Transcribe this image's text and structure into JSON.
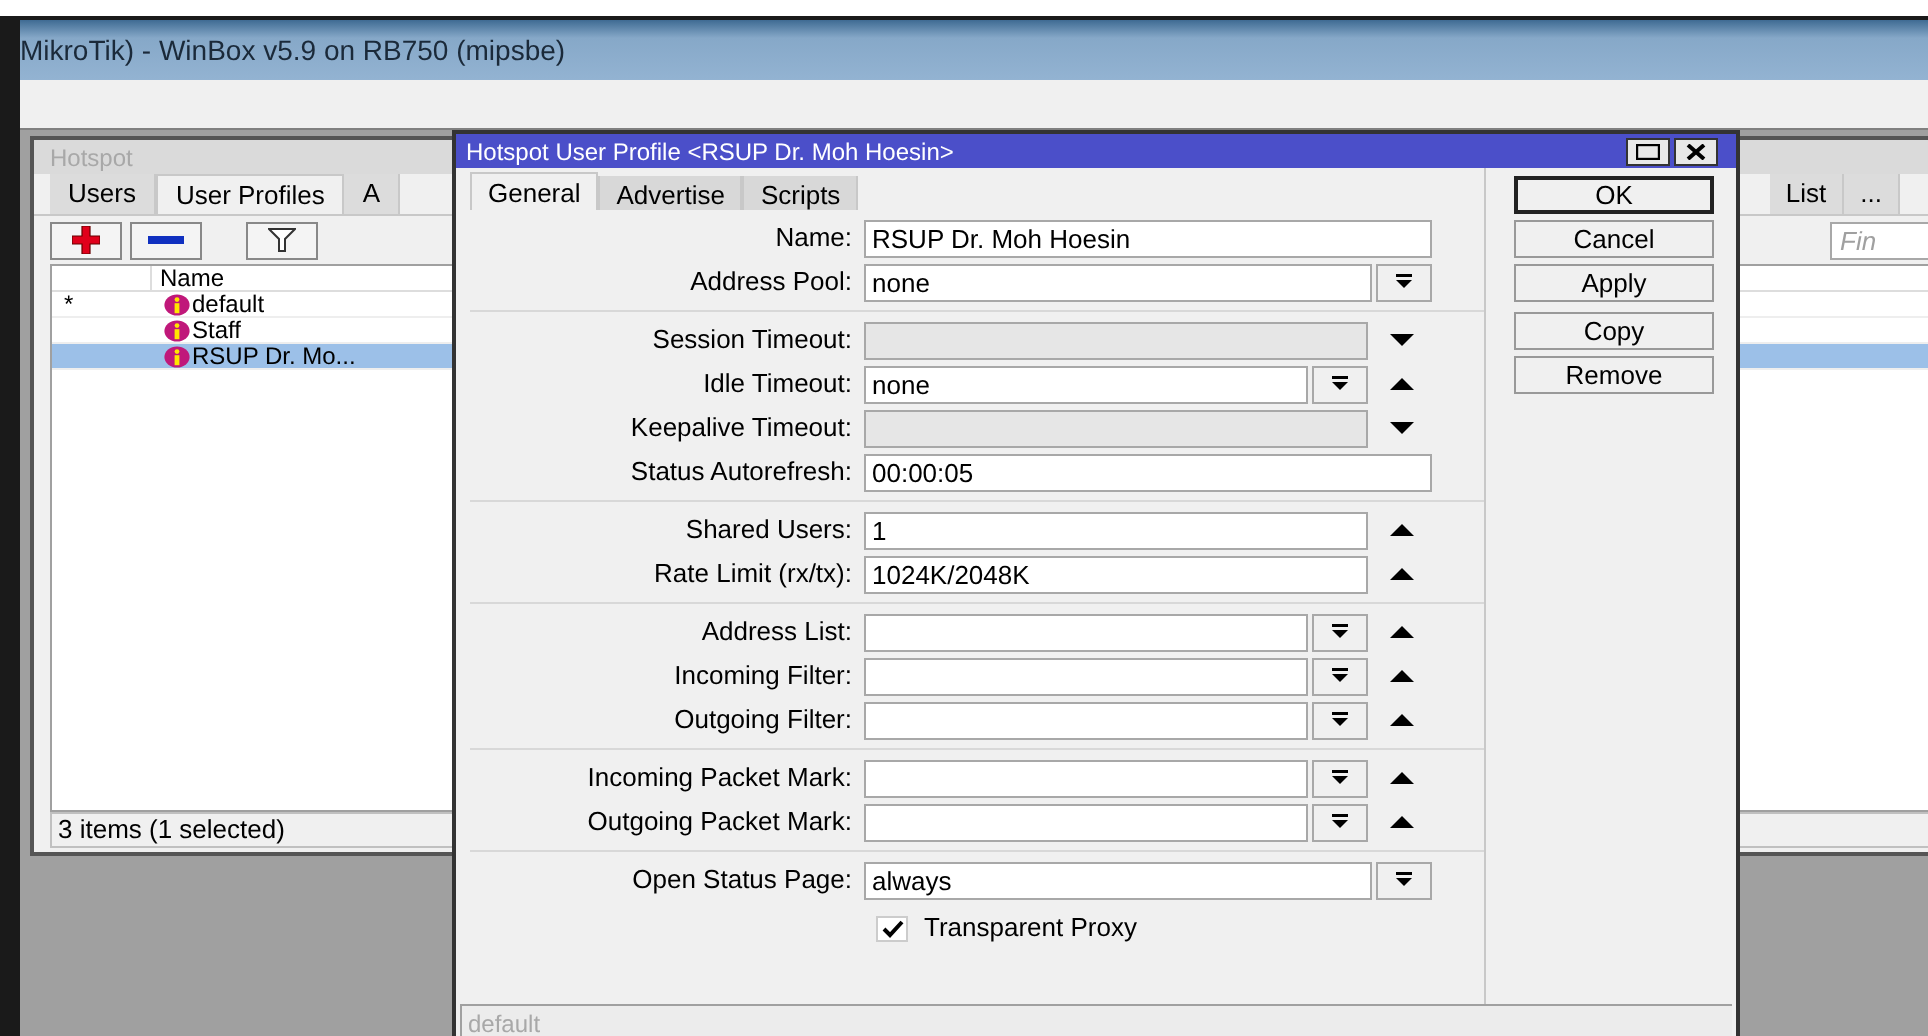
{
  "app_window": {
    "title": "MikroTik) - WinBox v5.9 on RB750 (mipsbe)"
  },
  "hotspot_window": {
    "title": "Hotspot",
    "tabs": [
      {
        "label": "Users",
        "selected": false
      },
      {
        "label": "User Profiles",
        "selected": true
      },
      {
        "label": "A",
        "selected": false
      }
    ],
    "right_tabs": [
      {
        "label": "List",
        "selected": false
      },
      {
        "label": "...",
        "selected": false
      }
    ],
    "find": {
      "placeholder": "Fin"
    },
    "table": {
      "columns": [
        "Name"
      ],
      "rows": [
        {
          "flag": "*",
          "name": "default",
          "selected": false
        },
        {
          "name": "Staff",
          "selected": false
        },
        {
          "name": "RSUP Dr. Mo...",
          "selected": true
        }
      ]
    },
    "status_bar": "3 items (1 selected)"
  },
  "dialog": {
    "title": "Hotspot User Profile <RSUP Dr. Moh Hoesin>",
    "tabs": [
      {
        "label": "General",
        "selected": true
      },
      {
        "label": "Advertise",
        "selected": false
      },
      {
        "label": "Scripts",
        "selected": false
      }
    ],
    "sections": [
      [
        {
          "kind": "plain",
          "label": "Name:",
          "value": "RSUP Dr. Moh Hoesin",
          "disabled": false,
          "dropdown": false
        },
        {
          "kind": "plain",
          "label": "Address Pool:",
          "value": "none",
          "disabled": false,
          "dropdown": true
        }
      ],
      [
        {
          "kind": "expandable",
          "label": "Session Timeout:",
          "disabled": true,
          "dropdown": false,
          "expanded": false
        },
        {
          "kind": "expandable",
          "label": "Idle Timeout:",
          "value": "none",
          "disabled": false,
          "dropdown": true,
          "expanded": true
        },
        {
          "kind": "expandable",
          "label": "Keepalive Timeout:",
          "disabled": true,
          "dropdown": false,
          "expanded": false
        },
        {
          "kind": "plain",
          "label": "Status Autorefresh:",
          "value": "00:00:05",
          "disabled": false,
          "dropdown": false
        }
      ],
      [
        {
          "kind": "expandable",
          "label": "Shared Users:",
          "value": "1",
          "disabled": false,
          "dropdown": false,
          "expanded": true
        },
        {
          "kind": "expandable",
          "label": "Rate Limit (rx/tx):",
          "value": "1024K/2048K",
          "disabled": false,
          "dropdown": false,
          "expanded": true
        }
      ],
      [
        {
          "kind": "expandable",
          "label": "Address List:",
          "disabled": false,
          "dropdown": true,
          "expanded": true
        },
        {
          "kind": "expandable",
          "label": "Incoming Filter:",
          "disabled": false,
          "dropdown": true,
          "expanded": true
        },
        {
          "kind": "expandable",
          "label": "Outgoing Filter:",
          "disabled": false,
          "dropdown": true,
          "expanded": true
        }
      ],
      [
        {
          "kind": "expandable",
          "label": "Incoming Packet Mark:",
          "disabled": false,
          "dropdown": true,
          "expanded": true
        },
        {
          "kind": "expandable",
          "label": "Outgoing Packet Mark:",
          "disabled": false,
          "dropdown": true,
          "expanded": true
        }
      ],
      [
        {
          "kind": "plain",
          "label": "Open Status Page:",
          "value": "always",
          "disabled": false,
          "dropdown": true
        }
      ]
    ],
    "checkbox": {
      "label": "Transparent Proxy",
      "checked": true
    },
    "button_groups": [
      [
        {
          "label": "OK",
          "default": true
        },
        {
          "label": "Cancel",
          "default": false
        },
        {
          "label": "Apply",
          "default": false
        }
      ],
      [
        {
          "label": "Copy",
          "default": false
        },
        {
          "label": "Remove",
          "default": false
        }
      ]
    ],
    "status_bar": "default"
  }
}
